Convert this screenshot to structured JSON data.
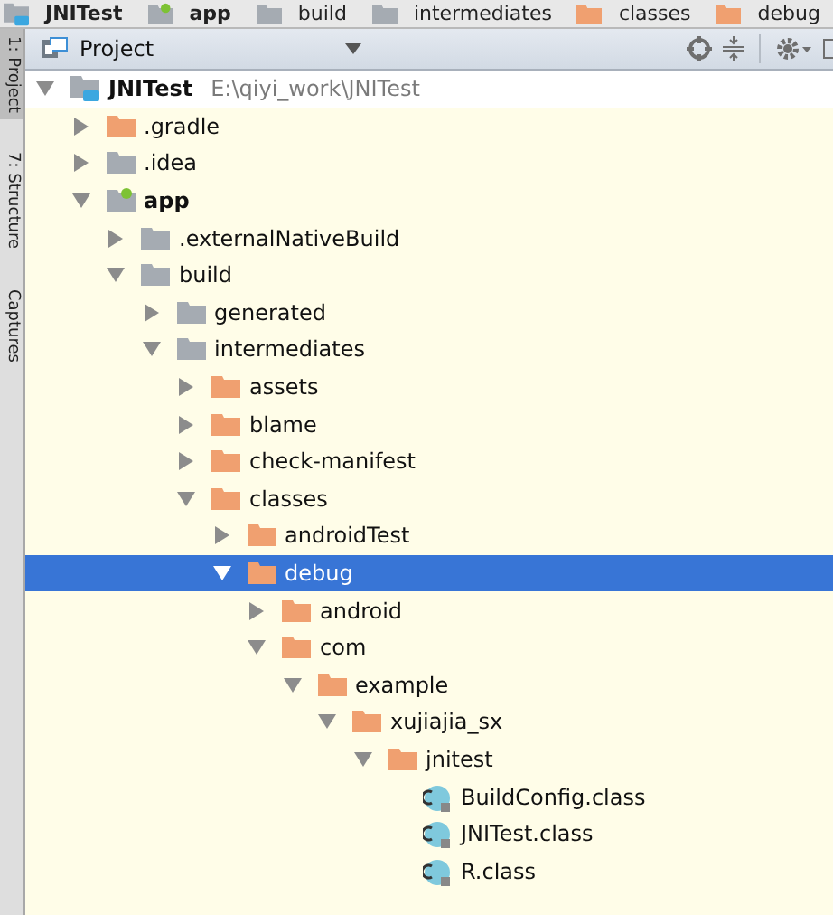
{
  "breadcrumbs": [
    {
      "label": "JNITest",
      "kind": "project"
    },
    {
      "label": "app",
      "kind": "module"
    },
    {
      "label": "build",
      "kind": "excluded-folder"
    },
    {
      "label": "intermediates",
      "kind": "excluded-folder"
    },
    {
      "label": "classes",
      "kind": "folder"
    },
    {
      "label": "debug",
      "kind": "folder"
    }
  ],
  "side_tabs": [
    {
      "label": "1: Project",
      "selected": true
    },
    {
      "label": "7: Structure",
      "selected": false
    },
    {
      "label": "Captures",
      "selected": false
    }
  ],
  "panel": {
    "title": "Project"
  },
  "tree": [
    {
      "label": "JNITest",
      "path": "E:\\qiyi_work\\JNITest",
      "kind": "project",
      "expanded": true,
      "selected": false,
      "children": [
        {
          "label": ".gradle",
          "kind": "folder",
          "expanded": false,
          "selected": false
        },
        {
          "label": ".idea",
          "kind": "excluded-folder",
          "expanded": false,
          "selected": false
        },
        {
          "label": "app",
          "kind": "module",
          "expanded": true,
          "selected": false,
          "children": [
            {
              "label": ".externalNativeBuild",
              "kind": "excluded-folder",
              "expanded": false,
              "selected": false
            },
            {
              "label": "build",
              "kind": "excluded-folder",
              "expanded": true,
              "selected": false,
              "children": [
                {
                  "label": "generated",
                  "kind": "excluded-folder",
                  "expanded": false,
                  "selected": false
                },
                {
                  "label": "intermediates",
                  "kind": "excluded-folder",
                  "expanded": true,
                  "selected": false,
                  "children": [
                    {
                      "label": "assets",
                      "kind": "folder",
                      "expanded": false,
                      "selected": false
                    },
                    {
                      "label": "blame",
                      "kind": "folder",
                      "expanded": false,
                      "selected": false
                    },
                    {
                      "label": "check-manifest",
                      "kind": "folder",
                      "expanded": false,
                      "selected": false
                    },
                    {
                      "label": "classes",
                      "kind": "folder",
                      "expanded": true,
                      "selected": false,
                      "children": [
                        {
                          "label": "androidTest",
                          "kind": "folder",
                          "expanded": false,
                          "selected": false
                        },
                        {
                          "label": "debug",
                          "kind": "folder",
                          "expanded": true,
                          "selected": true,
                          "children": [
                            {
                              "label": "android",
                              "kind": "folder",
                              "expanded": false,
                              "selected": false
                            },
                            {
                              "label": "com",
                              "kind": "folder",
                              "expanded": true,
                              "selected": false,
                              "children": [
                                {
                                  "label": "example",
                                  "kind": "folder",
                                  "expanded": true,
                                  "selected": false,
                                  "children": [
                                    {
                                      "label": "xujiajia_sx",
                                      "kind": "folder",
                                      "expanded": true,
                                      "selected": false,
                                      "children": [
                                        {
                                          "label": "jnitest",
                                          "kind": "folder",
                                          "expanded": true,
                                          "selected": false,
                                          "children": [
                                            {
                                              "label": "BuildConfig.class",
                                              "kind": "class",
                                              "selected": false
                                            },
                                            {
                                              "label": "JNITest.class",
                                              "kind": "class",
                                              "selected": false
                                            },
                                            {
                                              "label": "R.class",
                                              "kind": "class",
                                              "selected": false
                                            }
                                          ]
                                        }
                                      ]
                                    }
                                  ]
                                }
                              ]
                            }
                          ]
                        }
                      ]
                    }
                  ]
                }
              ]
            }
          ]
        }
      ]
    }
  ]
}
